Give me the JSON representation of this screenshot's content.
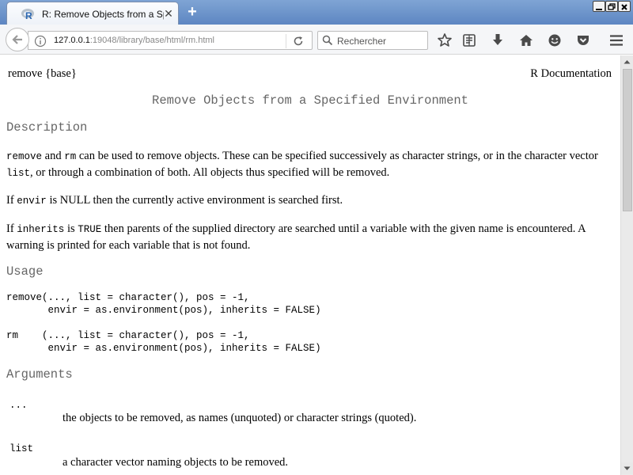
{
  "browser": {
    "tab_title": "R: Remove Objects from a Sp…",
    "new_tab_symbol": "+",
    "url_host": "127.0.0.1",
    "url_rest": ":19048/library/base/html/rm.html",
    "search_placeholder": "Rechercher",
    "icons": [
      "info-icon",
      "reload-icon",
      "search-icon",
      "star-icon",
      "reader-icon",
      "download-icon",
      "home-icon",
      "hello-icon",
      "pocket-icon",
      "menu-icon"
    ]
  },
  "doc": {
    "header_left": "remove {base}",
    "header_right": "R Documentation",
    "title": "Remove Objects from a Specified Environment",
    "sections": {
      "description": "Description",
      "usage": "Usage",
      "arguments": "Arguments"
    },
    "description": {
      "p1_code1": "remove",
      "p1_t1": " and ",
      "p1_code2": "rm",
      "p1_t2": " can be used to remove objects. These can be specified successively as character strings, or in the character vector ",
      "p1_code3": "list",
      "p1_t3": ", or through a combination of both. All objects thus specified will be removed.",
      "p2_t1": "If ",
      "p2_code1": "envir",
      "p2_t2": " is NULL then the currently active environment is searched first.",
      "p3_t1": "If ",
      "p3_code1": "inherits",
      "p3_t2": " is ",
      "p3_code2": "TRUE",
      "p3_t3": " then parents of the supplied directory are searched until a variable with the given name is encountered. A warning is printed for each variable that is not found."
    },
    "usage": {
      "remove_l1": "remove(..., list = character(), pos = -1,",
      "remove_l2": "       envir = as.environment(pos), inherits = FALSE)",
      "rm_l1": "rm    (..., list = character(), pos = -1,",
      "rm_l2": "       envir = as.environment(pos), inherits = FALSE)"
    },
    "arguments": [
      {
        "name": "...",
        "desc": "the objects to be removed, as names (unquoted) or character strings (quoted)."
      },
      {
        "name": "list",
        "desc": "a character vector naming objects to be removed."
      }
    ]
  }
}
